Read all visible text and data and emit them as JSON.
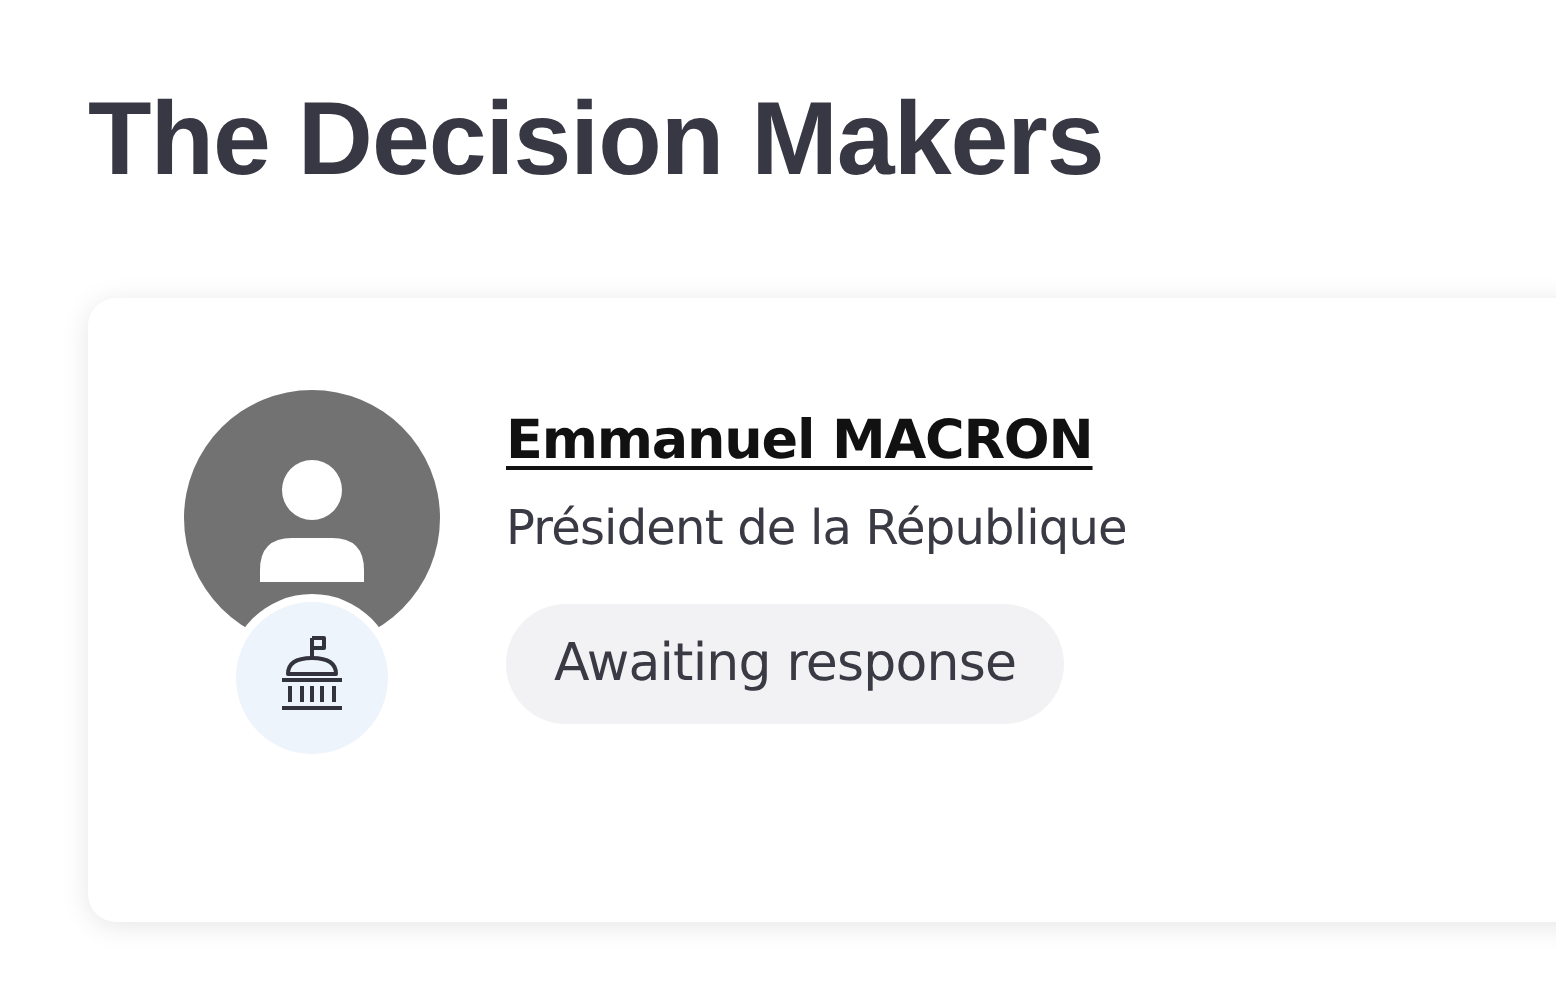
{
  "title": "The Decision Makers",
  "decision_makers": [
    {
      "name": "Emmanuel MACRON",
      "role": "Président de la République",
      "status": "Awaiting response"
    }
  ]
}
